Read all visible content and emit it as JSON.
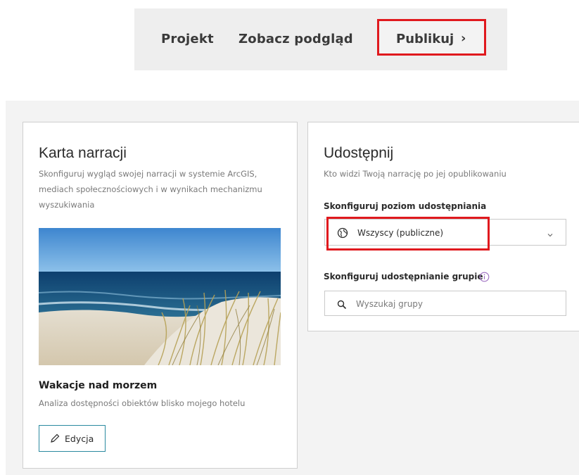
{
  "nav": {
    "items": [
      {
        "label": "Projekt"
      },
      {
        "label": "Zobacz podgląd"
      }
    ],
    "publish": {
      "label": "Publikuj",
      "icon": "chevron-right-icon",
      "chevron": "›"
    }
  },
  "story_card": {
    "title": "Karta narracji",
    "description": "Skonfiguruj wygląd swojej narracji w systemie ArcGIS, mediach społecznościowych i w wynikach mechanizmu wyszukiwania",
    "image": "beach-dunes-photo",
    "story_title": "Wakacje nad morzem",
    "story_subtitle": "Analiza dostępności obiektów blisko mojego hotelu",
    "edit_button": {
      "label": "Edycja",
      "icon": "pencil-icon"
    }
  },
  "share_card": {
    "title": "Udostępnij",
    "description": "Kto widzi Twoją narrację po jej opublikowaniu",
    "level_label": "Skonfiguruj poziom udostępniania",
    "level_value": "Wszyscy (publiczne)",
    "level_icon": "globe-icon",
    "group_label": "Skonfiguruj udostępnianie grupie",
    "group_info_icon": "info-icon",
    "group_search_placeholder": "Wyszukaj grupy"
  },
  "colors": {
    "highlight": "#e0191e",
    "accent": "#2b8aa0",
    "info": "#9b6bbf"
  }
}
